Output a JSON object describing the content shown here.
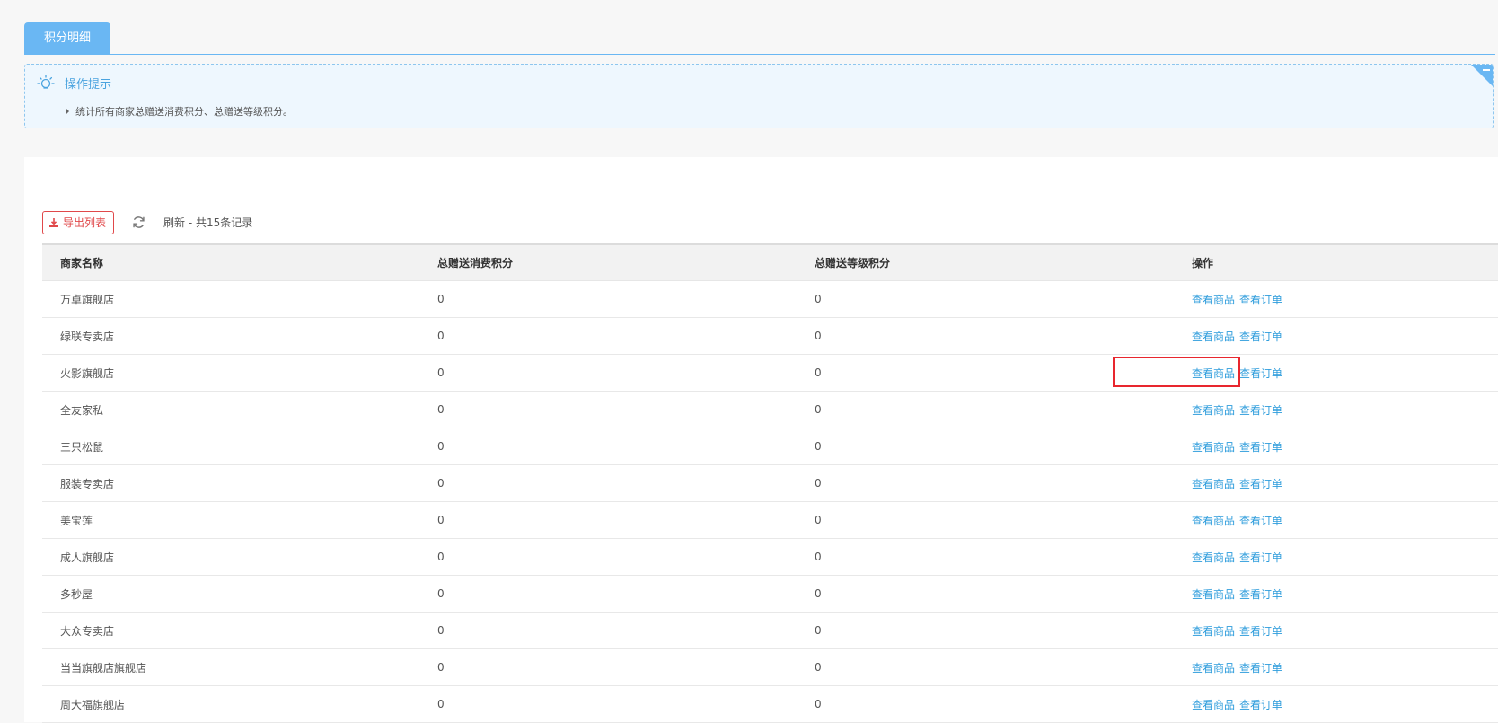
{
  "tabs": [
    {
      "label": "积分明细",
      "active": true
    }
  ],
  "tips": {
    "title": "操作提示",
    "items": [
      "统计所有商家总赠送消费积分、总赠送等级积分。"
    ]
  },
  "toolbar": {
    "export_label": "导出列表",
    "refresh_text": "刷新 - 共15条记录"
  },
  "table": {
    "columns": [
      "商家名称",
      "总赠送消费积分",
      "总赠送等级积分",
      "操作"
    ],
    "rows": [
      {
        "name": "万卓旗舰店",
        "consume_points": "0",
        "level_points": "0"
      },
      {
        "name": "绿联专卖店",
        "consume_points": "0",
        "level_points": "0"
      },
      {
        "name": "火影旗舰店",
        "consume_points": "0",
        "level_points": "0"
      },
      {
        "name": "全友家私",
        "consume_points": "0",
        "level_points": "0"
      },
      {
        "name": "三只松鼠",
        "consume_points": "0",
        "level_points": "0"
      },
      {
        "name": "服装专卖店",
        "consume_points": "0",
        "level_points": "0"
      },
      {
        "name": "美宝莲",
        "consume_points": "0",
        "level_points": "0"
      },
      {
        "name": "成人旗舰店",
        "consume_points": "0",
        "level_points": "0"
      },
      {
        "name": "多秒屋",
        "consume_points": "0",
        "level_points": "0"
      },
      {
        "name": "大众专卖店",
        "consume_points": "0",
        "level_points": "0"
      },
      {
        "name": "当当旗舰店旗舰店",
        "consume_points": "0",
        "level_points": "0"
      },
      {
        "name": "周大福旗舰店",
        "consume_points": "0",
        "level_points": "0"
      }
    ],
    "actions": {
      "view_goods": "查看商品",
      "view_orders": "查看订单"
    }
  },
  "colors": {
    "accent": "#6ab7f3",
    "link": "#2f9ddc",
    "export_red": "#e0484a",
    "highlight_red": "#e8262e"
  },
  "icons": {
    "tips": "lightbulb-icon",
    "export": "download-icon",
    "refresh": "refresh-icon",
    "collapse": "minus-icon"
  }
}
